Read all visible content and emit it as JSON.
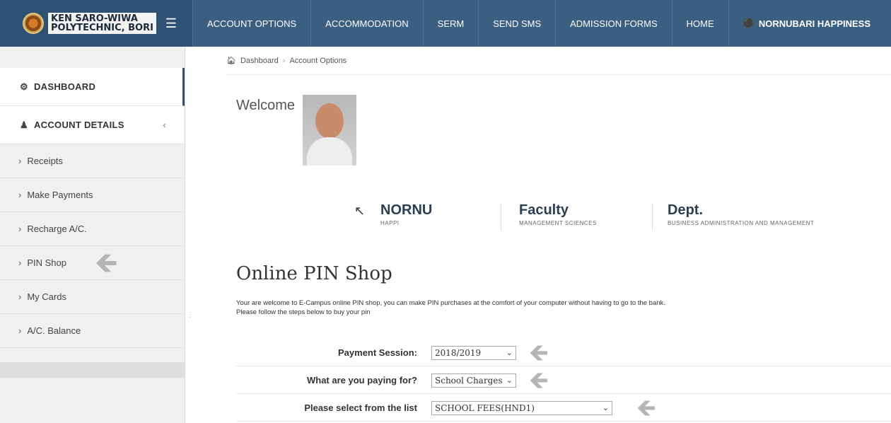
{
  "brand": {
    "line1": "KEN SARO-WIWA",
    "line2": "POLYTECHNIC, BORI"
  },
  "nav": {
    "items": [
      "ACCOUNT OPTIONS",
      "ACCOMMODATION",
      "SERM",
      "SEND SMS",
      "ADMISSION FORMS",
      "HOME"
    ],
    "user": "NORNUBARI HAPPINESS"
  },
  "sidebar": {
    "dashboard": "DASHBOARD",
    "account_details": "ACCOUNT DETAILS",
    "items": [
      "Receipts",
      "Make Payments",
      "Recharge A/C.",
      "PIN Shop",
      "My Cards",
      "A/C. Balance"
    ]
  },
  "breadcrumb": {
    "home": "Dashboard",
    "current": "Account Options"
  },
  "welcome": "Welcome",
  "profile": {
    "name": "NORNU",
    "name_sub": "HAPPI",
    "faculty_label": "Faculty",
    "faculty_value": "MANAGEMENT SCIENCES",
    "dept_label": "Dept.",
    "dept_value": "BUSINESS ADMINISTRATION AND MANAGEMENT"
  },
  "pin_shop": {
    "title": "Online PIN Shop",
    "desc1": "Your are welcome to E-Campus online PIN shop, you can make PIN purchases at the comfort of your computer without having to go to the bank.",
    "desc2": "Please follow the steps below to buy your pin"
  },
  "form": {
    "session_label": "Payment Session:",
    "session_value": "2018/2019",
    "paying_label": "What are you paying for?",
    "paying_value": "School Charges",
    "list_label": "Please select from the list",
    "list_value": "SCHOOL FEES(HND1)"
  }
}
